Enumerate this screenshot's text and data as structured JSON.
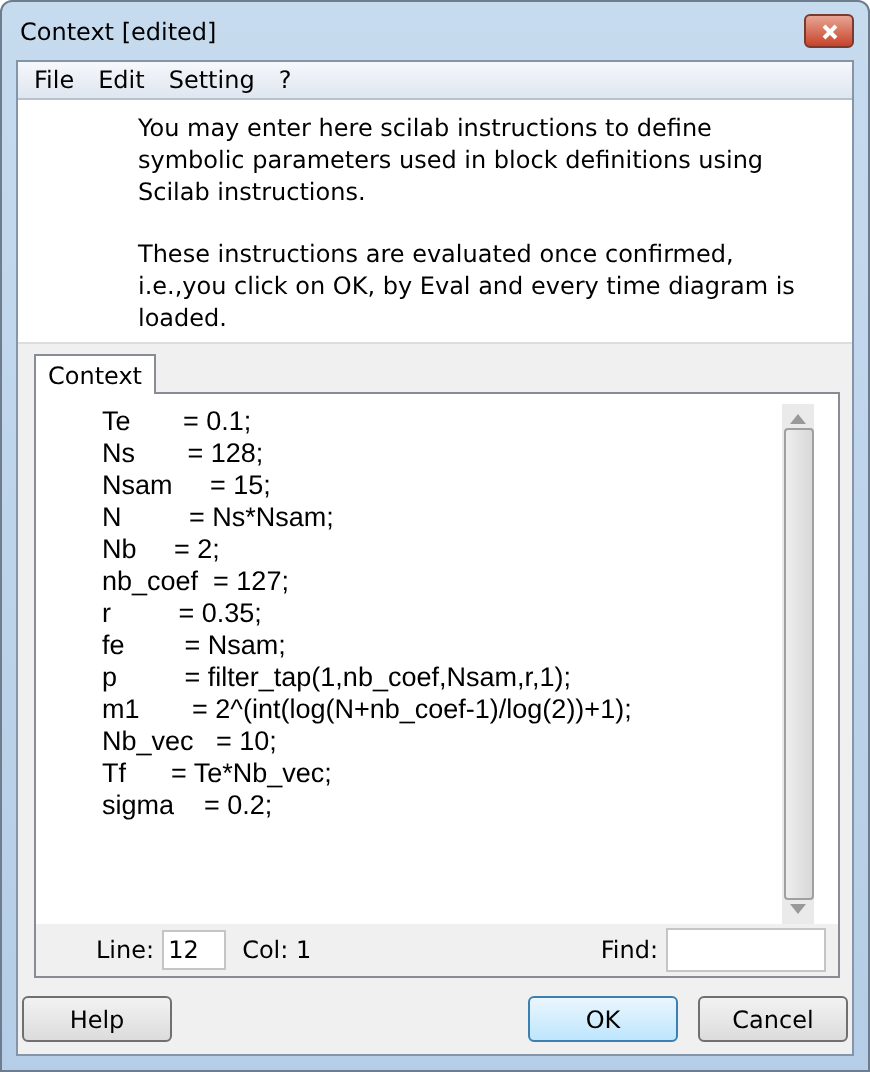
{
  "window": {
    "title": "Context [edited]"
  },
  "menu": [
    "File",
    "Edit",
    "Setting",
    "?"
  ],
  "info": [
    "You may enter here scilab instructions to define symbolic parameters used in block definitions using Scilab instructions.",
    "These instructions are evaluated once confirmed, i.e.,you click on OK, by Eval and every time diagram is loaded."
  ],
  "tabs": [
    {
      "label": "Context",
      "selected": true
    }
  ],
  "code_lines": [
    "Te       = 0.1;",
    "Ns       = 128;",
    "Nsam     = 15;",
    "N         = Ns*Nsam;",
    "Nb     = 2;",
    "nb_coef  = 127;",
    "r         = 0.35;",
    "fe        = Nsam;",
    "p         = filter_tap(1,nb_coef,Nsam,r,1);",
    "m1       = 2^(int(log(N+nb_coef-1)/log(2))+1);",
    "Nb_vec   = 10;",
    "Tf      = Te*Nb_vec;",
    "sigma    = 0.2;"
  ],
  "status": {
    "line_label": "Line:",
    "line_value": "12",
    "col_label": "Col: 1",
    "find_label": "Find:"
  },
  "buttons": [
    {
      "label": "Help",
      "default": false
    },
    {
      "label": "OK",
      "default": true
    },
    {
      "label": "Cancel",
      "default": false
    }
  ]
}
